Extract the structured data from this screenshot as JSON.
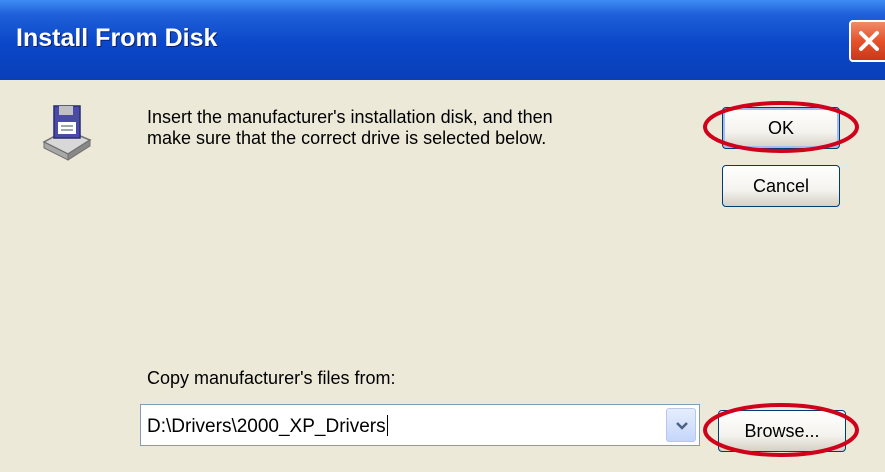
{
  "window": {
    "title": "Install From Disk",
    "close_icon": "close-icon"
  },
  "message": {
    "line1": "Insert the manufacturer's installation disk, and then",
    "line2": "make sure that the correct drive is selected below.",
    "icon": "floppy-drive-icon"
  },
  "buttons": {
    "ok": "OK",
    "cancel": "Cancel",
    "browse": "Browse..."
  },
  "copy_from": {
    "label": "Copy manufacturer's files from:",
    "value": "D:\\Drivers\\2000_XP_Drivers",
    "dropdown_icon": "chevron-down-icon"
  },
  "annotations": {
    "color": "#d0021b",
    "marked": [
      "OK",
      "Browse..."
    ]
  }
}
